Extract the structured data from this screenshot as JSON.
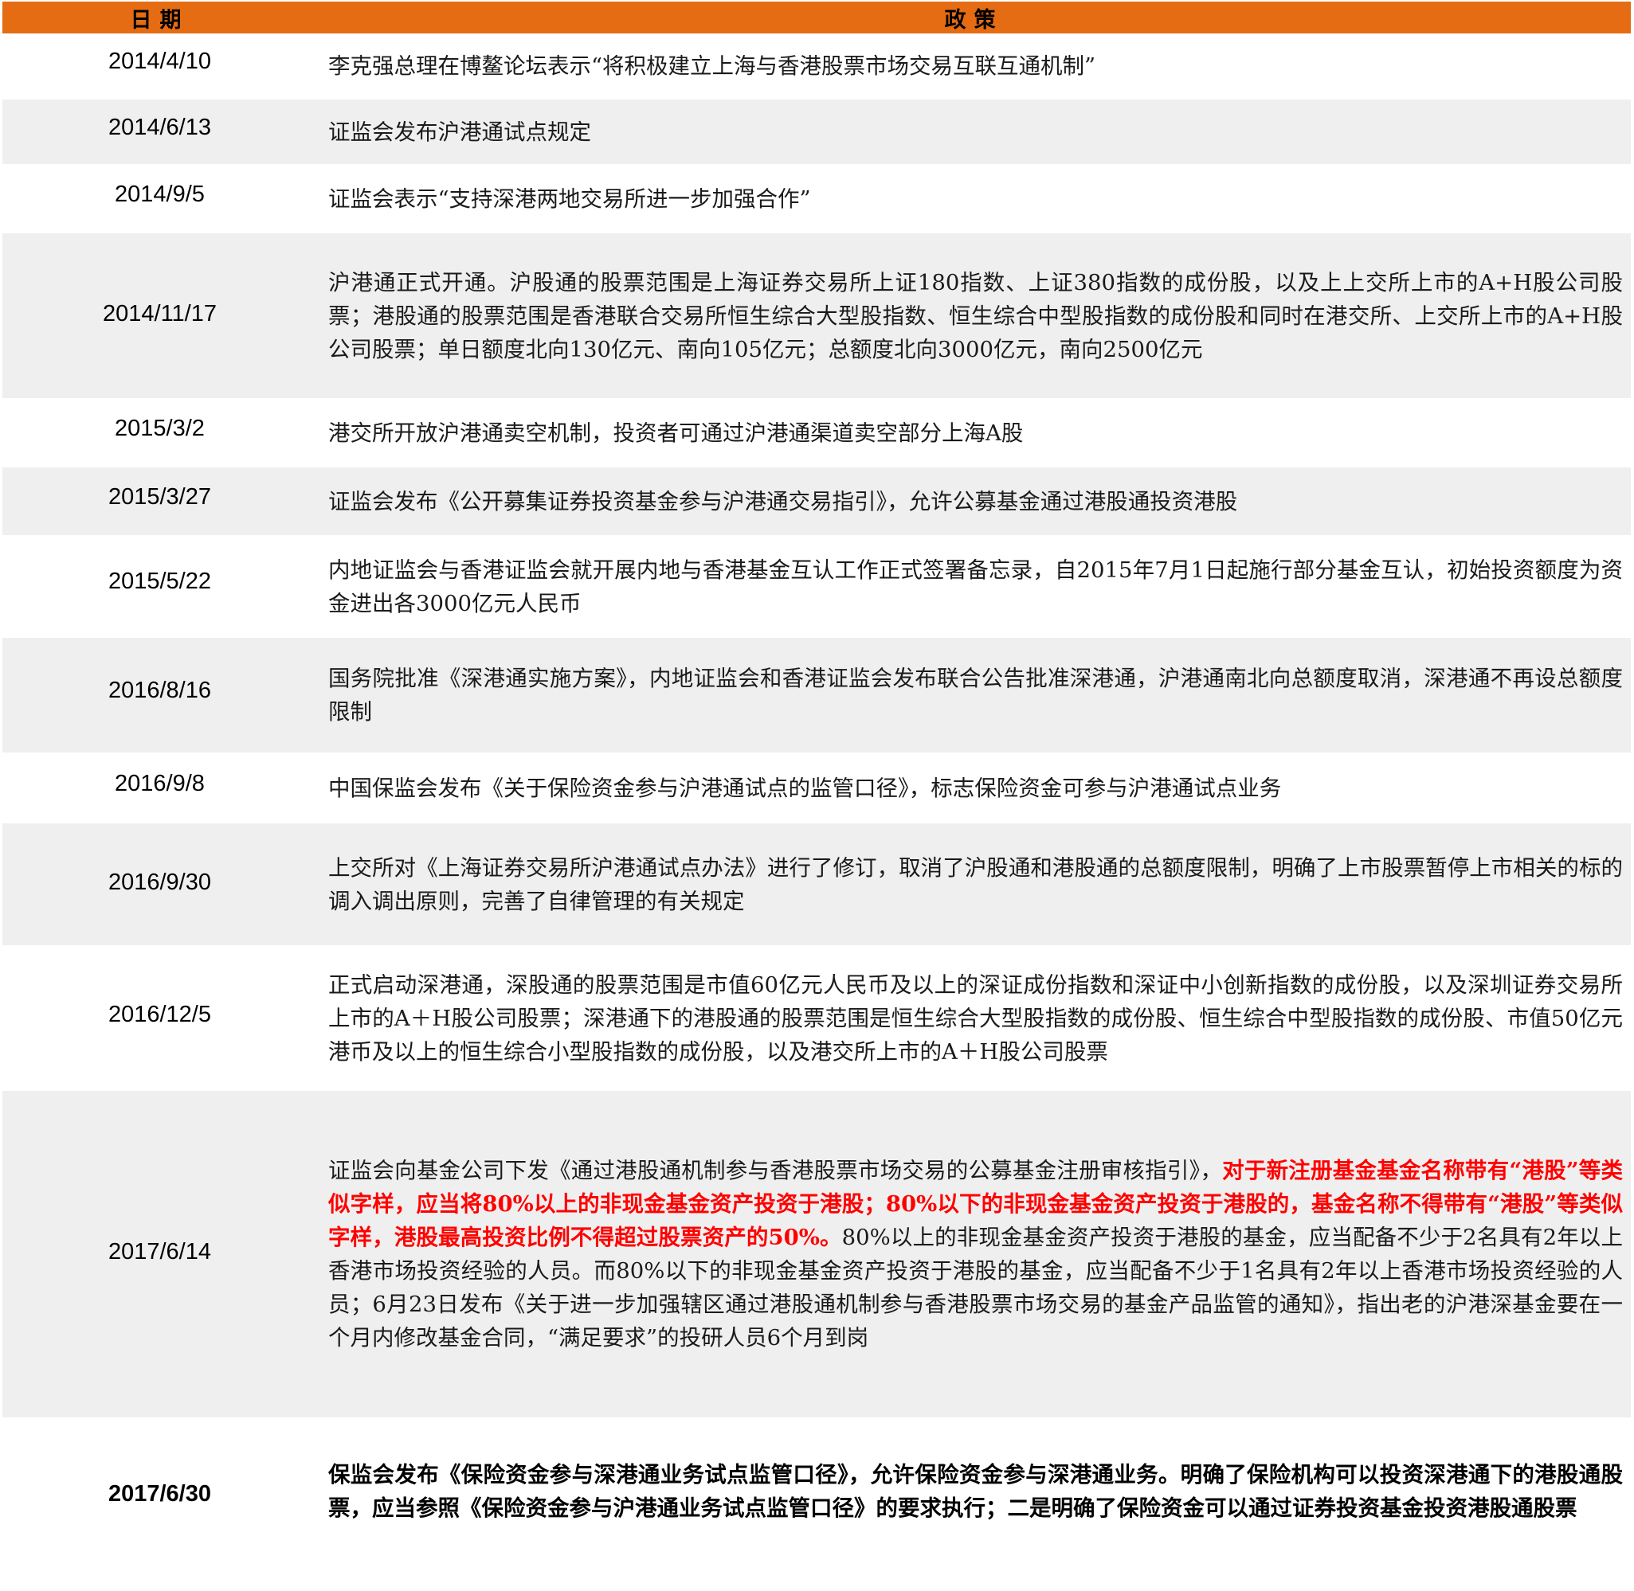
{
  "header": {
    "date_label": "日期",
    "policy_label": "政策"
  },
  "colors": {
    "header_bg": "#e56c12",
    "row_alt_bg": "#efefef",
    "highlight": "#ff0000"
  },
  "rows": [
    {
      "date": "2014/4/10",
      "policy": "李克强总理在博鳌论坛表示“将积极建立上海与香港股票市场交易互联互通机制”"
    },
    {
      "date": "2014/6/13",
      "policy": "证监会发布沪港通试点规定"
    },
    {
      "date": "2014/9/5",
      "policy": "证监会表示“支持深港两地交易所进一步加强合作”"
    },
    {
      "date": "2014/11/17",
      "policy": "沪港通正式开通。沪股通的股票范围是上海证券交易所上证180指数、上证380指数的成份股，以及上上交所上市的A+H股公司股票；港股通的股票范围是香港联合交易所恒生综合大型股指数、恒生综合中型股指数的成份股和同时在港交所、上交所上市的A+H股公司股票；单日额度北向130亿元、南向105亿元；总额度北向3000亿元，南向2500亿元"
    },
    {
      "date": "2015/3/2",
      "policy": "港交所开放沪港通卖空机制，投资者可通过沪港通渠道卖空部分上海A股"
    },
    {
      "date": "2015/3/27",
      "policy": "证监会发布《公开募集证券投资基金参与沪港通交易指引》，允许公募基金通过港股通投资港股"
    },
    {
      "date": "2015/5/22",
      "policy": "内地证监会与香港证监会就开展内地与香港基金互认工作正式签署备忘录，自2015年7月1日起施行部分基金互认，初始投资额度为资金进出各3000亿元人民币"
    },
    {
      "date": "2016/8/16",
      "policy": "国务院批准《深港通实施方案》，内地证监会和香港证监会发布联合公告批准深港通，沪港通南北向总额度取消，深港通不再设总额度限制"
    },
    {
      "date": "2016/9/8",
      "policy": "中国保监会发布《关于保险资金参与沪港通试点的监管口径》，标志保险资金可参与沪港通试点业务"
    },
    {
      "date": "2016/9/30",
      "policy": "上交所对《上海证券交易所沪港通试点办法》进行了修订，取消了沪股通和港股通的总额度限制，明确了上市股票暂停上市相关的标的调入调出原则，完善了自律管理的有关规定"
    },
    {
      "date": "2016/12/5",
      "policy": "正式启动深港通，深股通的股票范围是市值60亿元人民币及以上的深证成份指数和深证中小创新指数的成份股，以及深圳证券交易所上市的A＋H股公司股票；深港通下的港股通的股票范围是恒生综合大型股指数的成份股、恒生综合中型股指数的成份股、市值50亿元港币及以上的恒生综合小型股指数的成份股，以及港交所上市的A＋H股公司股票"
    },
    {
      "date": "2017/6/14",
      "policy_intro": "证监会向基金公司下发《通过港股通机制参与香港股票市场交易的公募基金注册审核指引》，",
      "policy_highlight": "对于新注册基金基金名称带有“港股”等类似字样，应当将80%以上的非现金基金资产投资于港股；80%以下的非现金基金资产投资于港股的，基金名称不得带有“港股”等类似字样，港股最高投资比例不得超过股票资产的50%。",
      "policy_rest": "80%以上的非现金基金资产投资于港股的基金，应当配备不少于2名具有2年以上香港市场投资经验的人员。而80%以下的非现金基金资产投资于港股的基金，应当配备不少于1名具有2年以上香港市场投资经验的人员；6月23日发布《关于进一步加强辖区通过港股通机制参与香港股票市场交易的基金产品监管的通知》，指出老的沪港深基金要在一个月内修改基金合同，“满足要求”的投研人员6个月到岗"
    },
    {
      "date": "2017/6/30",
      "policy": "保监会发布《保险资金参与深港通业务试点监管口径》，允许保险资金参与深港通业务。明确了保险机构可以投资深港通下的港股通股票，应当参照《保险资金参与沪港通业务试点监管口径》的要求执行；二是明确了保险资金可以通过证券投资基金投资港股通股票"
    }
  ]
}
